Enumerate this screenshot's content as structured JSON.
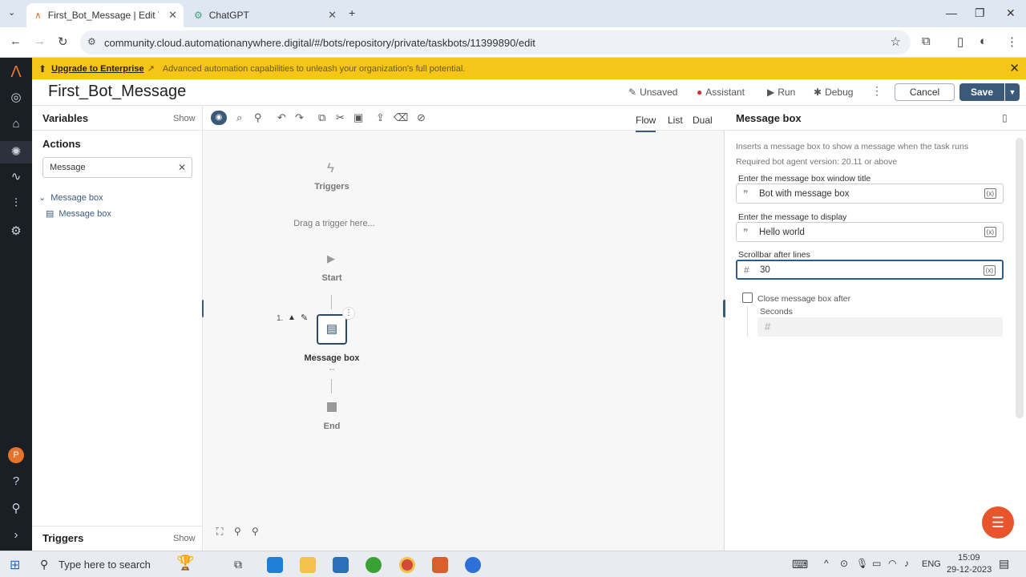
{
  "browser": {
    "tabs": [
      {
        "title": "First_Bot_Message | Edit Task Bo",
        "active": true
      },
      {
        "title": "ChatGPT",
        "active": false
      }
    ],
    "url": "community.cloud.automationanywhere.digital/#/bots/repository/private/taskbots/11399890/edit"
  },
  "banner": {
    "upgrade_label": "Upgrade to Enterprise",
    "message": "Advanced automation capabilities to unleash your organization's full potential."
  },
  "header": {
    "bot_title": "First_Bot_Message",
    "unsaved_label": "Unsaved",
    "assistant_label": "Assistant",
    "run_label": "Run",
    "debug_label": "Debug",
    "cancel_label": "Cancel",
    "save_label": "Save"
  },
  "leftpanel": {
    "variables_label": "Variables",
    "variables_show": "Show",
    "actions_label": "Actions",
    "search_value": "Message",
    "tree_group": "Message box",
    "tree_item": "Message box",
    "triggers_label": "Triggers",
    "triggers_show": "Show"
  },
  "canvas": {
    "views": [
      "Flow",
      "List",
      "Dual"
    ],
    "active_view": "Flow",
    "triggers_label": "Triggers",
    "drag_hint": "Drag a trigger here...",
    "start_label": "Start",
    "node_number": "1.",
    "node_label": "Message box",
    "node_sub": "--",
    "end_label": "End"
  },
  "rightpanel": {
    "title": "Message box",
    "description": "Inserts a message box to show a message when the task runs",
    "version_note": "Required bot agent version: 20.11 or above",
    "field1_label": "Enter the message box window title",
    "field1_value": "Bot with message box",
    "field2_label": "Enter the message to display",
    "field2_value": "Hello world",
    "field3_label": "Scrollbar after lines",
    "field3_value": "30",
    "checkbox_label": "Close message box after",
    "seconds_label": "Seconds"
  },
  "taskbar": {
    "search_placeholder": "Type here to search",
    "lang": "ENG",
    "time": "15:09",
    "date": "29-12-2023"
  },
  "colors": {
    "banner": "#f5c518",
    "primary": "#3b5a7a",
    "rail": "#1a1f26"
  }
}
